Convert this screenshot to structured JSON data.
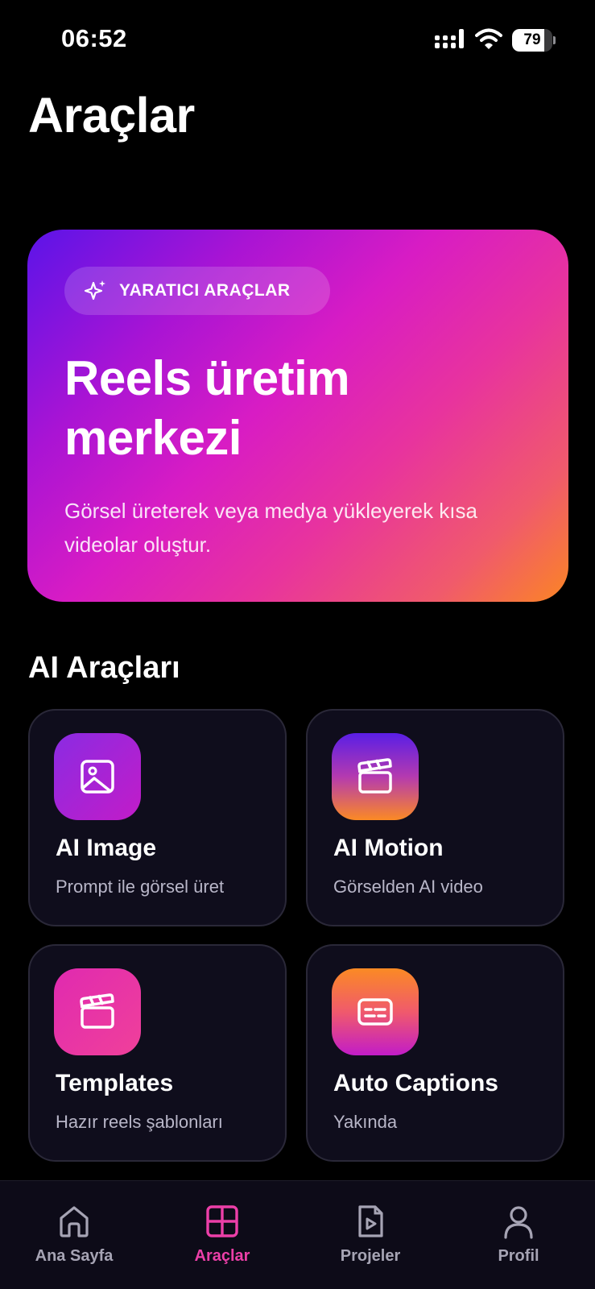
{
  "status_bar": {
    "time": "06:52",
    "battery_percent": 79
  },
  "page": {
    "title": "Araçlar"
  },
  "hero": {
    "badge_label": "YARATICI ARAÇLAR",
    "badge_icon": "sparkles-icon",
    "title": "Reels üretim merkezi",
    "description": "Görsel üreterek veya medya yükleyerek kısa videolar oluştur."
  },
  "section": {
    "title": "AI Araçları"
  },
  "tools": [
    {
      "title": "AI Image",
      "subtitle": "Prompt ile görsel üret",
      "icon": "image-icon"
    },
    {
      "title": "AI Motion",
      "subtitle": "Görselden AI video",
      "icon": "clapperboard-icon"
    },
    {
      "title": "Templates",
      "subtitle": "Hazır reels şablonları",
      "icon": "clapperboard-icon"
    },
    {
      "title": "Auto Captions",
      "subtitle": "Yakında",
      "icon": "captions-icon"
    }
  ],
  "tab_bar": {
    "active": "Araçlar",
    "items": [
      {
        "label": "Ana Sayfa",
        "icon": "home-icon"
      },
      {
        "label": "Araçlar",
        "icon": "grid-icon"
      },
      {
        "label": "Projeler",
        "icon": "video-file-icon"
      },
      {
        "label": "Profil",
        "icon": "user-icon"
      }
    ]
  },
  "colors": {
    "background": "#000000",
    "card": "#0f0d1c",
    "accent": "#ec3fa8",
    "inactive_tab": "#a6a4b4"
  }
}
